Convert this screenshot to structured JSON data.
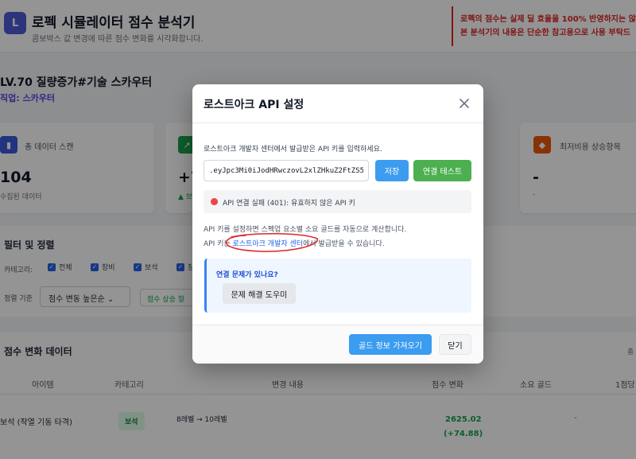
{
  "app": {
    "logo_letter": "L",
    "title": "로펙 시뮬레이터 점수 분석기",
    "subtitle": "콤보박스 값 변경에 따른 점수 변화를 시각화합니다.",
    "warning_line1": "로펙의 점수는 실제 딜 효율을 100% 반영하지는 않",
    "warning_line2": "본 분석기의 내용은 단순한 참고용으로 사용 부탁드"
  },
  "character": {
    "name": "LV.70 질량증가#기술 스카우터",
    "job": "직업: 스카우터"
  },
  "cards": [
    {
      "icon": "bar-chart-icon",
      "label": "총 데이터 스캔",
      "value": "104",
      "sub": "수집된 데이터"
    },
    {
      "icon": "trend-icon",
      "label": "",
      "value": "+7",
      "sub": "▲ 보"
    },
    {
      "icon": "gem-icon",
      "label": "최저비용 상승항목",
      "value": "-",
      "sub": "-"
    }
  ],
  "filters": {
    "title": "필터 및 정렬",
    "category_label": "카테고리:",
    "checkboxes": [
      "전체",
      "장비",
      "보석",
      "장"
    ],
    "sort_label": "정렬 기준",
    "sort_value": "점수 변동 높은순",
    "toggle_label": "점수 상승 항"
  },
  "table": {
    "title": "점수 변화 데이터",
    "right_text": "총",
    "headers": [
      "아이템",
      "카테고리",
      "변경 내용",
      "점수 변화",
      "소요 골드",
      "1점당"
    ],
    "row": {
      "item": "보석 (작열 기동 타격)",
      "category": "보석",
      "change": "8레벨 → 10레벨",
      "score": "2625.02",
      "delta": "(+74.88)",
      "gold": "-"
    }
  },
  "modal": {
    "title": "로스트아크 API 설정",
    "description": "로스트아크 개발자 센터에서 발급받은 API 키를 입력하세요.",
    "api_key_value": ".eyJpc3Mi0iJodHRwczovL2xlZHkuZ2FtZS5v",
    "save_label": "저장",
    "test_label": "연결 테스트",
    "status_text": "API 연결 실패 (401): 유효하지 않은 API 키",
    "info_line1": "API 키를 설정하면 스펙업 요소별 소요 골드를 자동으로 계산합니다.",
    "info_line2_pre": "API 키는 ",
    "info_link": "로스트아크 개발자 센터",
    "info_line2_post": "에서 발급받을 수 있습니다.",
    "help_question": "연결 문제가 있나요?",
    "help_button": "문제 해결 도우미",
    "fetch_gold_label": "골드 정보 가져오기",
    "close_label": "닫기"
  },
  "colors": {
    "accent": "#3b9cf0",
    "success": "#4caf50",
    "error": "#ef4444",
    "warning_text": "#dc2626"
  }
}
